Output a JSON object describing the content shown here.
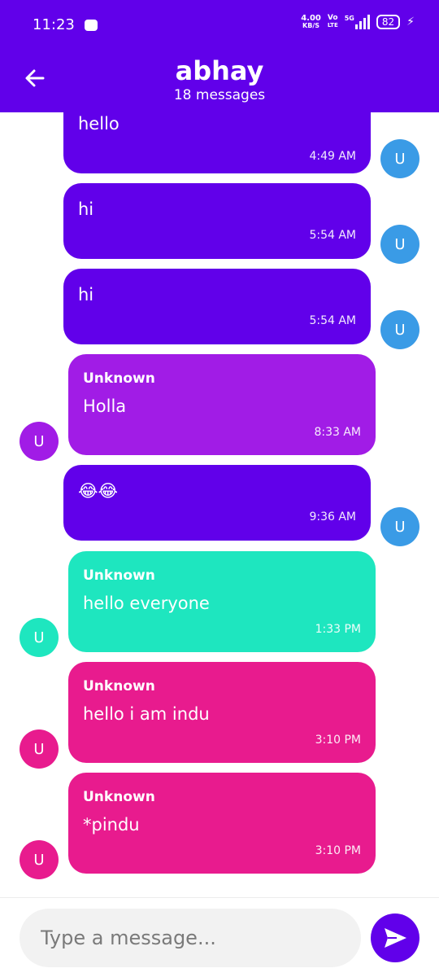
{
  "status_bar": {
    "time": "11:23",
    "speed_value": "4.00",
    "speed_unit": "KB/S",
    "volte_top": "Vo",
    "volte_bottom": "LTE",
    "network": "5G",
    "battery": "82"
  },
  "header": {
    "title": "abhay",
    "subtitle": "18 messages",
    "back_icon": "arrow-left-icon"
  },
  "messages": [
    {
      "side": "right",
      "sender": "",
      "text": "hello",
      "time": "4:49 AM",
      "avatar": "U",
      "color": "#6100ea",
      "avatar_color": "#3a9be6"
    },
    {
      "side": "right",
      "sender": "",
      "text": "hi",
      "time": "5:54 AM",
      "avatar": "U",
      "color": "#6100ea",
      "avatar_color": "#3a9be6"
    },
    {
      "side": "right",
      "sender": "",
      "text": "hi",
      "time": "5:54 AM",
      "avatar": "U",
      "color": "#6100ea",
      "avatar_color": "#3a9be6"
    },
    {
      "side": "left",
      "sender": "Unknown",
      "text": "Holla",
      "time": "8:33 AM",
      "avatar": "U",
      "color": "#a11ce6",
      "avatar_color": "#a11ce6"
    },
    {
      "side": "right",
      "sender": "",
      "text": "😂😂",
      "time": "9:36 AM",
      "avatar": "U",
      "color": "#6100ea",
      "avatar_color": "#3a9be6"
    },
    {
      "side": "left",
      "sender": "Unknown",
      "text": "hello everyone",
      "time": "1:33 PM",
      "avatar": "U",
      "color": "#1ee6bf",
      "avatar_color": "#1ee6bf"
    },
    {
      "side": "left",
      "sender": "Unknown",
      "text": "hello i am indu",
      "time": "3:10 PM",
      "avatar": "U",
      "color": "#e81b8e",
      "avatar_color": "#e81b8e"
    },
    {
      "side": "left",
      "sender": "Unknown",
      "text": "*pindu",
      "time": "3:10 PM",
      "avatar": "U",
      "color": "#e81b8e",
      "avatar_color": "#e81b8e"
    }
  ],
  "composer": {
    "placeholder": "Type a message...",
    "send_icon": "send-icon"
  }
}
